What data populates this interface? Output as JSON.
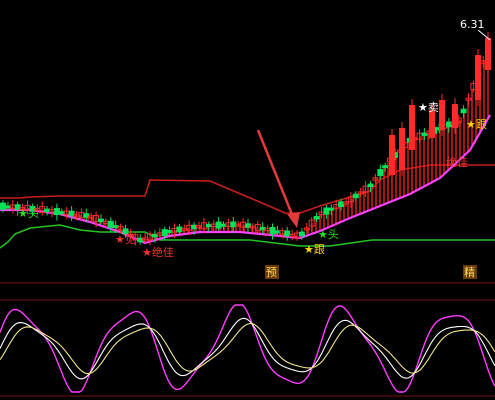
{
  "chart_data": [
    {
      "type": "candlestick",
      "role": "main-price-panel",
      "high_label": "6.31",
      "x_count": 100,
      "up_color": "#ff2a2a",
      "down_color": "#00e05a",
      "series": [
        {
          "name": "",
          "kind": "channel-upper",
          "color": "#c81e1e",
          "values": [
            5.34,
            5.34,
            5.34,
            5.34,
            5.34,
            5.34,
            5.34,
            5.34,
            5.34,
            5.34,
            5.34,
            5.34,
            5.34,
            5.34,
            5.34,
            5.34,
            5.34,
            5.34,
            5.34,
            5.34,
            5.34,
            5.34,
            5.34,
            5.34,
            5.34,
            5.34,
            5.34,
            5.34,
            5.34,
            5.34,
            5.38,
            5.38,
            5.38,
            5.38,
            5.38,
            5.38,
            5.38,
            5.38,
            5.38,
            5.38,
            5.38,
            5.38,
            5.38,
            5.38,
            5.38,
            5.38,
            5.38,
            5.38,
            5.38,
            5.38,
            5.38,
            5.38,
            5.38,
            5.38,
            5.38,
            5.38,
            5.38,
            5.38,
            5.38,
            5.38,
            5.38,
            5.38,
            5.38,
            5.38,
            5.38,
            5.38,
            5.38,
            5.38,
            5.38,
            5.38,
            5.38,
            5.38,
            5.38,
            5.38,
            5.38,
            5.38,
            5.38,
            5.38,
            5.38,
            5.38,
            5.38,
            5.38,
            5.38,
            5.38,
            5.38,
            5.38,
            5.38,
            5.38,
            5.38,
            5.38,
            5.38,
            5.38,
            5.38,
            5.38,
            5.38,
            5.38,
            5.38,
            5.38,
            5.38,
            5.38
          ]
        },
        {
          "name": "",
          "kind": "channel-lower",
          "color": "#22c522",
          "values": [
            5.02,
            5.02,
            5.03,
            5.05,
            5.06,
            5.07,
            5.07,
            5.07,
            5.07,
            5.07,
            5.07,
            5.07,
            5.07,
            5.07,
            5.07,
            5.07,
            5.07,
            5.07,
            5.07,
            5.07,
            5.07,
            5.07,
            5.07,
            5.07,
            5.07,
            5.07,
            5.07,
            5.07,
            5.06,
            5.04,
            5.02,
            5.02,
            5.02,
            5.02,
            5.02,
            5.02,
            5.02,
            5.02,
            5.02,
            5.02,
            5.02,
            5.02,
            5.02,
            5.02,
            5.02,
            5.02,
            5.02,
            5.02,
            5.02,
            5.02,
            5.02,
            5.02,
            5.02,
            5.02,
            5.02,
            5.02,
            5.02,
            5.02,
            5.02,
            5.02,
            5.02,
            5.02,
            5.02,
            5.02,
            5.02,
            5.02,
            5.02,
            5.02,
            5.02,
            5.02,
            5.02,
            5.02,
            5.05,
            5.05,
            5.05,
            5.05,
            5.05,
            5.05,
            5.05,
            5.05,
            5.05,
            5.05,
            5.05,
            5.05,
            5.05,
            5.05,
            5.05,
            5.05,
            5.05,
            5.05,
            5.05,
            5.05,
            5.05,
            5.05,
            5.05,
            5.05,
            5.05,
            5.05,
            5.05,
            5.05
          ]
        }
      ],
      "annotations": [
        {
          "text": "★头",
          "color": "#22e022",
          "x": 5
        },
        {
          "text": "★见",
          "color": "#ff3030",
          "x": 30
        },
        {
          "text": "★绝佳",
          "color": "#ff3030",
          "x": 31
        },
        {
          "text": "★头",
          "color": "#22e022",
          "x": 64
        },
        {
          "text": "★跟",
          "color": "#ffd400",
          "x": 62
        },
        {
          "text": "★卖",
          "color": "#ffffff",
          "x": 86
        },
        {
          "text": "★跟",
          "color": "#ffd400",
          "x": 95
        },
        {
          "text": "绝佳",
          "color": "#ff3030",
          "x": 92
        }
      ],
      "arrow": {
        "color": "#e23a3a",
        "to_x": 60
      }
    },
    {
      "type": "line",
      "role": "oscillator-panel",
      "markers": [
        {
          "text": "预",
          "x": 55
        },
        {
          "text": "精",
          "x": 95
        }
      ],
      "series": [
        {
          "name": "",
          "color": "#ff3cff",
          "kind": "main"
        },
        {
          "name": "",
          "color": "#ffffff",
          "kind": "signal"
        },
        {
          "name": "",
          "color": "#f0e68c",
          "kind": "slow"
        }
      ]
    }
  ]
}
